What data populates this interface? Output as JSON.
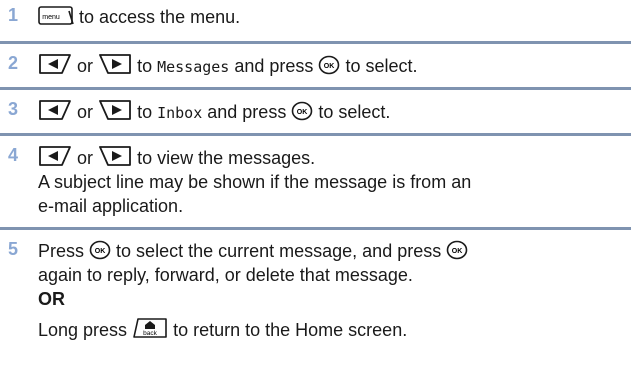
{
  "steps": [
    {
      "number": "1",
      "key": "menu",
      "text": "to access the menu."
    },
    {
      "number": "2",
      "or": "or",
      "to": "to",
      "target": "Messages",
      "press": "and press",
      "end": "to select."
    },
    {
      "number": "3",
      "or": "or",
      "to": "to",
      "target": "Inbox",
      "press": "and press",
      "end": "to select."
    },
    {
      "number": "4",
      "or": "or",
      "text": "to view the messages.",
      "note_line1": "A subject line may be shown if the message is from an",
      "note_line2": "e-mail application."
    },
    {
      "number": "5",
      "line1_a": "Press",
      "line1_b": "to select the current message, and press",
      "line2": "again to reply, forward, or delete that message.",
      "or_word": "OR",
      "line4_a": "Long press",
      "back_key": "back",
      "line4_b": "to return to the Home screen."
    }
  ],
  "icons": {
    "ok_label": "OK"
  }
}
